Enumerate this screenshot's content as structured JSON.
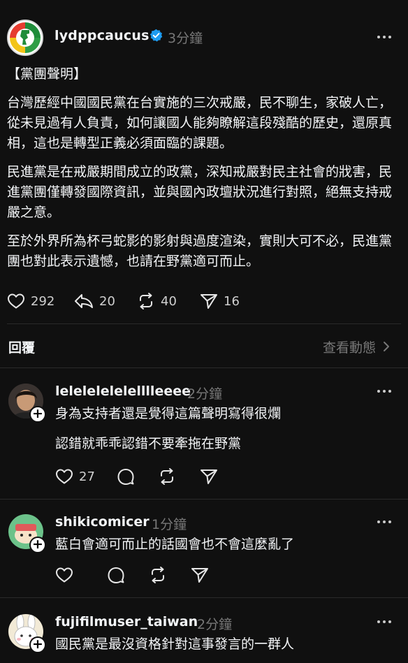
{
  "post": {
    "username": "lydppcaucus",
    "verified": true,
    "time": "3分鐘",
    "paragraphs": [
      "【黨團聲明】",
      "台灣歷經中國國民黨在台實施的三次戒嚴，民不聊生，家破人亡，從未見過有人負責，如何讓國人能夠瞭解這段殘酷的歷史，還原真相，這也是轉型正義必須面臨的課題。",
      "民進黨是在戒嚴期間成立的政黨，深知戒嚴對民主社會的戕害，民進黨團僅轉發國際資訊，並與國內政壇狀況進行對照，絕無支持戒嚴之意。",
      "至於外界所為杯弓蛇影的影射與過度渲染，實則大可不必，民進黨團也對此表示遺憾，也請在野黨適可而止。"
    ],
    "likes": "292",
    "replies": "20",
    "reposts": "40",
    "shares": "16"
  },
  "replies_section": {
    "title": "回覆",
    "view_activity": "查看動態"
  },
  "replies": [
    {
      "username": "lelelelelelelllleeee",
      "time": "2分鐘",
      "lines": [
        "身為支持者還是覺得這篇聲明寫得很爛",
        "認錯就乖乖認錯不要牽拖在野黨"
      ],
      "likes": "27"
    },
    {
      "username": "shikicomicer",
      "time": "1分鐘",
      "lines": [
        "藍白會適可而止的話國會也不會這麼亂了"
      ],
      "likes": ""
    },
    {
      "username": "fujifilmuser_taiwan",
      "time": "2分鐘",
      "lines": [
        "國民黨是最沒資格針對這事發言的一群人"
      ],
      "likes": ""
    }
  ],
  "colors": {
    "background": "#101010",
    "text": "#f3f5f7",
    "muted": "#777777",
    "verified": "#1d9bf0",
    "divider": "#2a2a2a"
  }
}
